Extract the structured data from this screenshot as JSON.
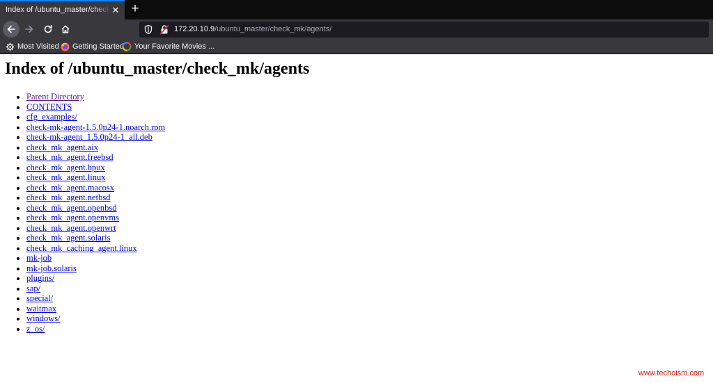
{
  "tab": {
    "title": "Index of /ubuntu_master/check_mk/agents/",
    "close": "✕",
    "new_tab": "+"
  },
  "address": {
    "host": "172.20.10.9",
    "path": "/ubuntu_master/check_mk/agents/"
  },
  "bookmarks": [
    {
      "label": "Most Visited",
      "icon": "gear-icon"
    },
    {
      "label": "Getting Started",
      "icon": "firefox-icon"
    },
    {
      "label": "Your Favorite Movies ...",
      "icon": "movies-icon"
    }
  ],
  "page": {
    "heading": "Index of /ubuntu_master/check_mk/agents",
    "entries": [
      "Parent Directory",
      "CONTENTS",
      "cfg_examples/",
      "check-mk-agent-1.5.0p24-1.noarch.rpm",
      "check-mk-agent_1.5.0p24-1_all.deb",
      "check_mk_agent.aix",
      "check_mk_agent.freebsd",
      "check_mk_agent.hpux",
      "check_mk_agent.linux",
      "check_mk_agent.macosx",
      "check_mk_agent.netbsd",
      "check_mk_agent.openbsd",
      "check_mk_agent.openvms",
      "check_mk_agent.openwrt",
      "check_mk_agent.solaris",
      "check_mk_caching_agent.linux",
      "mk-job",
      "mk-job.solaris",
      "plugins/",
      "sap/",
      "special/",
      "waitmax",
      "windows/",
      "z_os/"
    ]
  },
  "watermark": "www.techoism.com",
  "colors": {
    "link": "#0000ee",
    "visited_link": "#551a8b",
    "chrome_dark": "#38383d",
    "tab_accent": "#0a84ff",
    "watermark": "#e0120b"
  }
}
